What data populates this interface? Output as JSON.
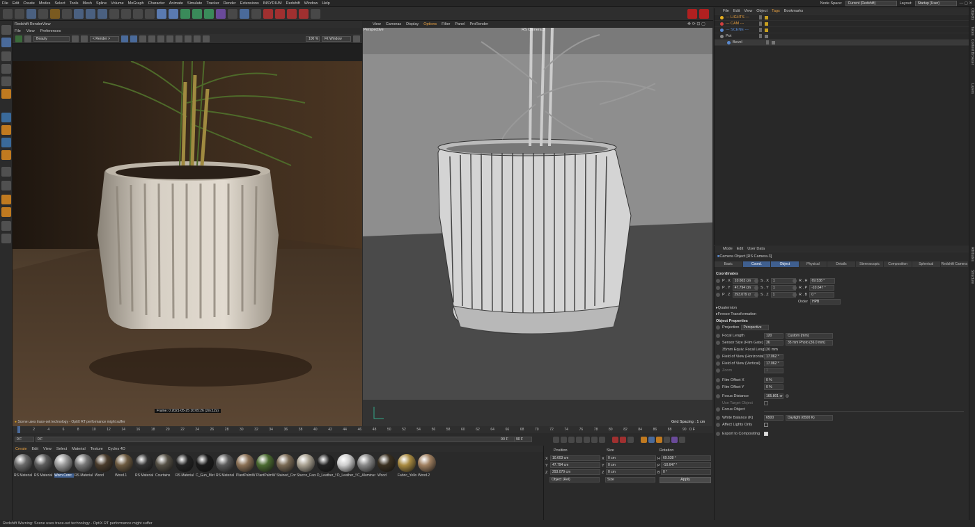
{
  "menu": [
    "File",
    "Edit",
    "Create",
    "Modes",
    "Select",
    "Tools",
    "Mesh",
    "Spline",
    "Volume",
    "MoGraph",
    "Character",
    "Animate",
    "Simulate",
    "Tracker",
    "Render",
    "Extensions",
    "INSYDIUM",
    "Redshift",
    "Window",
    "Help"
  ],
  "topright": {
    "node_space_label": "Node Space:",
    "node_space_value": "Current (Redshift)",
    "layout_label": "Layout:",
    "layout_value": "Startup (User)"
  },
  "renderview": {
    "title": "Redshift RenderView",
    "menu": [
      "File",
      "View",
      "Preferences"
    ],
    "beauty": "Beauty",
    "render": "< Render >",
    "zoom": "100 %",
    "fit": "Fit Window",
    "frame_info": "Frame: 0   2021-05-25  10:05:26  (2m:12s)",
    "warning": "Scene uses trace-set technology - OptiX RT performance might suffer"
  },
  "viewport": {
    "menu": [
      "View",
      "Cameras",
      "Display",
      "Options",
      "Filter",
      "Panel",
      "ProRender"
    ],
    "label": "Perspective",
    "camera": "RS Camera.3",
    "grid": "Grid Spacing : 1 cm"
  },
  "objects": {
    "menu": [
      "File",
      "Edit",
      "View",
      "Object",
      "Tags",
      "Bookmarks"
    ],
    "rows": [
      "--- LIGHTS ---",
      "--- CAM ---",
      "--- SCENE ---",
      "Pot",
      "Bevel"
    ]
  },
  "attributes": {
    "menu": [
      "Mode",
      "Edit",
      "User Data"
    ],
    "title": "Camera Object [RS Camera.3]",
    "tabs": [
      "Basic",
      "Coord.",
      "Object",
      "Physical",
      "Details",
      "Stereoscopic",
      "Composition",
      "Spherical",
      "Redshift Camera"
    ],
    "coords_heading": "Coordinates",
    "px": "10.603 cm",
    "py": "47.794 cm",
    "pz": "293.079 cr",
    "sx": "1",
    "sy": "1",
    "sz": "1",
    "rh": "69.538 °",
    "rp": "-10.647 °",
    "rb": "0 °",
    "order_label": "Order",
    "order": "HPB",
    "quaternion": "Quaternion",
    "freeze": "Freeze Transformation",
    "objprops": "Object Properties",
    "projection_label": "Projection",
    "projection": "Perspective",
    "focal_label": "Focal Length",
    "focal": "120",
    "focal_preset": "Custom (mm)",
    "sensor_label": "Sensor Size (Film Gate)",
    "sensor": "36",
    "sensor_preset": "35 mm Photo (36.0 mm)",
    "equiv_label": "35mm Equiv. Focal Length",
    "equiv": "120 mm",
    "fovh_label": "Field of View (Horizontal)",
    "fovh": "17.062 °",
    "fovv_label": "Field of View (Vertical)",
    "fovv": "17.062 °",
    "zoom_label": "Zoom",
    "zoom": "1",
    "offx_label": "Film Offset X",
    "offx": "0 %",
    "offy_label": "Film Offset Y",
    "offy": "0 %",
    "focusd_label": "Focus Distance",
    "focusd": "165.801 cr",
    "target_label": "Use Target Object",
    "focuso_label": "Focus Object",
    "wb_label": "White Balance (K)",
    "wb": "6500",
    "wb_preset": "Daylight (6500 K)",
    "affect_label": "Affect Lights Only",
    "export_label": "Export to Compositing"
  },
  "timeline": {
    "ticks": [
      "0",
      "2",
      "4",
      "6",
      "8",
      "10",
      "12",
      "14",
      "16",
      "18",
      "20",
      "22",
      "24",
      "26",
      "28",
      "30",
      "32",
      "34",
      "36",
      "38",
      "40",
      "42",
      "44",
      "46",
      "48",
      "50",
      "52",
      "54",
      "56",
      "58",
      "60",
      "62",
      "64",
      "66",
      "68",
      "70",
      "72",
      "74",
      "76",
      "78",
      "80",
      "82",
      "84",
      "86",
      "88",
      "90"
    ],
    "frame_end": "0 F",
    "start": "0 F",
    "cur": "0 F",
    "end1": "90 F",
    "end2": "90 F"
  },
  "materials": {
    "menu": [
      "Create",
      "Edit",
      "View",
      "Select",
      "Material",
      "Texture",
      "Cycles 4D"
    ],
    "items": [
      "RS Material",
      "RS Material",
      "Worn Conc",
      "RS Material",
      "Wood",
      "Wood.1",
      "RS Material",
      "Courtains",
      "RS Material",
      "C_Gun_Met",
      "RS Material",
      "PlantPalmW",
      "PlantPalmW",
      "Stained_Con",
      "Stucco_Faca",
      "D_Leather_S",
      "D_Leather_S",
      "C_Aluminur",
      "Wood",
      "Fabric_Yello",
      "Wood.2"
    ],
    "colors": [
      "#6a6a6a",
      "#5c5c5c",
      "#9a9a9a",
      "#777",
      "#4a3c2c",
      "#6c5a40",
      "#333",
      "#555045",
      "#222",
      "#1a1a1a",
      "#5a5a5a",
      "#8a7055",
      "#4a6a30",
      "#7a6a55",
      "#a8a090",
      "#222",
      "#cfcfcf",
      "#888",
      "#3a3020",
      "#a88a40",
      "#a08060"
    ]
  },
  "coordmgr": {
    "h_position": "Position",
    "h_size": "Size",
    "h_rotation": "Rotation",
    "rows": [
      {
        "a": "X",
        "p": "10.603 cm",
        "s": "0 cm",
        "r": "H",
        "rv": "69.538 °"
      },
      {
        "a": "Y",
        "p": "47.794 cm",
        "s": "0 cm",
        "r": "P",
        "rv": "-10.647 °"
      },
      {
        "a": "Z",
        "p": "293.079 cm",
        "s": "0 cm",
        "r": "B",
        "rv": "0 °"
      }
    ],
    "mode": "Object (Rel)",
    "size": "Size",
    "apply": "Apply"
  },
  "status": "Redshift Warning: Scene uses trace-set technology - OptiX RT performance might suffer",
  "sidebar": [
    "Objects",
    "Takes",
    "Content Browser",
    "Layers",
    "Attributes",
    "Structure"
  ],
  "accent": "#3f5f8f"
}
